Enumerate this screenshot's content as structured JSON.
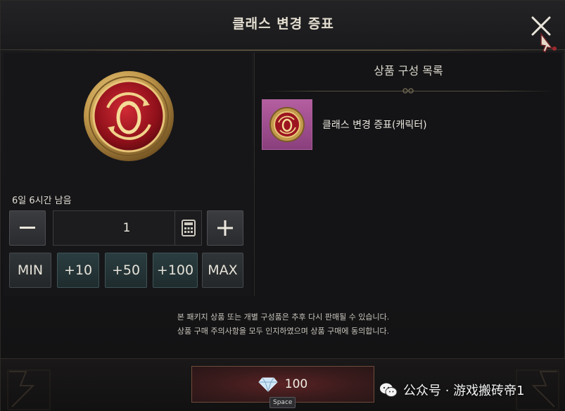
{
  "dialog": {
    "title": "클래스 변경 증표"
  },
  "purchase": {
    "time_remaining": "6일 6시간 남음",
    "quantity": "1",
    "minus_icon": "minus-icon",
    "plus_icon": "plus-icon",
    "steps": [
      "MIN",
      "+10",
      "+50",
      "+100",
      "MAX"
    ]
  },
  "contents": {
    "header": "상품 구성 목록",
    "items": [
      {
        "name": "클래스 변경 증표(캐릭터)",
        "icon": "class-change-token-icon"
      }
    ]
  },
  "notice": {
    "line1": "본 패키지 상품 또는 개별 구성품은 추후 다시 판매될 수 있습니다.",
    "line2": "상품 구매 주의사항을 모두 인지하였으며 상품 구매에 동의합니다."
  },
  "buy": {
    "price": "100",
    "currency_icon": "diamond-icon",
    "hotkey": "Space"
  },
  "watermark": {
    "text": "公众号 · 游戏搬砖帝1"
  },
  "colors": {
    "accent_gold": "#c9a45a",
    "token_red": "#a0141c",
    "item_thumb_bg": "#a34f90",
    "buy_button": "#4a1e20"
  }
}
